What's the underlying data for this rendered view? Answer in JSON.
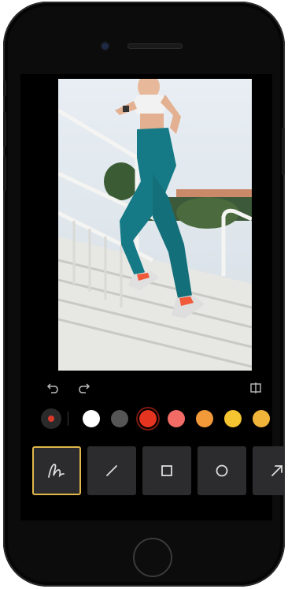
{
  "device": {
    "name": "phone",
    "home_button": "home-button"
  },
  "editor": {
    "photo": {
      "subject": "runner-on-stadium-steps"
    },
    "toolbar": {
      "undo_icon": "undo-icon",
      "redo_icon": "redo-icon",
      "compare_icon": "compare-icon"
    },
    "current_color": "#d9392b",
    "palette": [
      {
        "name": "white",
        "color": "#ffffff",
        "selected": false
      },
      {
        "name": "gray",
        "color": "#555555",
        "selected": false
      },
      {
        "name": "red",
        "color": "#e53420",
        "selected": true
      },
      {
        "name": "coral",
        "color": "#f26b64",
        "selected": false
      },
      {
        "name": "orange",
        "color": "#f29a3a",
        "selected": false
      },
      {
        "name": "yellow",
        "color": "#f5c531",
        "selected": false
      },
      {
        "name": "amber",
        "color": "#f0b43a",
        "selected": false
      }
    ],
    "tools": [
      {
        "name": "freehand",
        "icon": "pen-scribble-icon",
        "active": true
      },
      {
        "name": "line",
        "icon": "line-icon",
        "active": false
      },
      {
        "name": "rectangle",
        "icon": "square-icon",
        "active": false
      },
      {
        "name": "ellipse",
        "icon": "circle-icon",
        "active": false
      },
      {
        "name": "arrow",
        "icon": "arrow-icon",
        "active": false
      }
    ],
    "accent_color": "#e0b84a"
  }
}
